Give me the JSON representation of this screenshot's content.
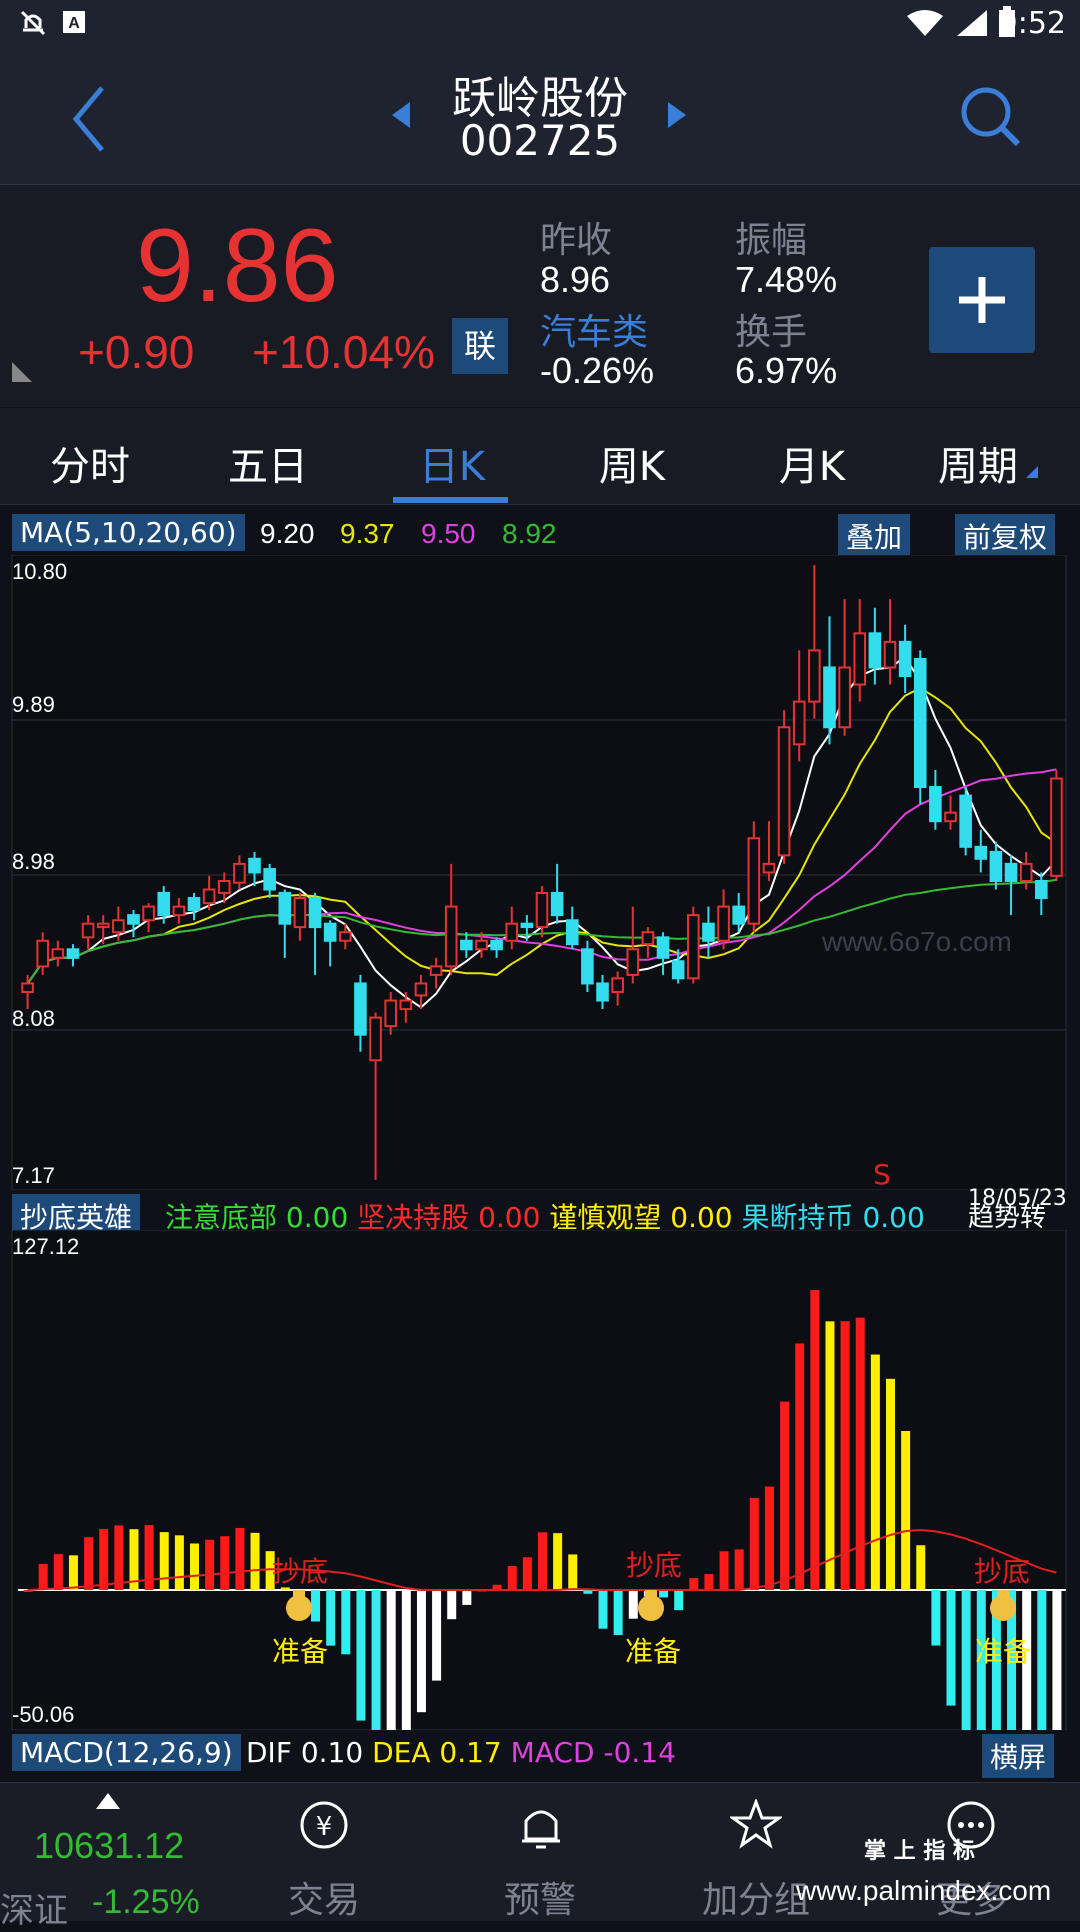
{
  "status": {
    "time": "9:52"
  },
  "header": {
    "name": "跃岭股份",
    "code": "002725"
  },
  "quote": {
    "price": "9.86",
    "change": "+0.90",
    "change_pct": "+10.04%",
    "lian": "联",
    "prev_close_label": "昨收",
    "prev_close": "8.96",
    "amplitude_label": "振幅",
    "amplitude": "7.48%",
    "sector": "汽车类",
    "sector_chg": "-0.26%",
    "turnover_label": "换手",
    "turnover": "6.97%"
  },
  "tabs": [
    {
      "label": "分时"
    },
    {
      "label": "五日"
    },
    {
      "label": "日K"
    },
    {
      "label": "周K"
    },
    {
      "label": "月K"
    },
    {
      "label": "周期"
    }
  ],
  "ma_legend": {
    "name": "MA(5,10,20,60)",
    "ma5": "9.20",
    "ma10": "9.37",
    "ma20": "9.50",
    "ma60": "8.92",
    "overlay": "叠加",
    "adjust": "前复权"
  },
  "kline_axis": [
    "10.80",
    "9.89",
    "8.98",
    "8.08",
    "7.17"
  ],
  "watermark": "www.6o7o.com",
  "signal_legend": {
    "name": "抄底英雄",
    "items": [
      {
        "label": "注意底部",
        "value": "0.00",
        "color": "#33dd33"
      },
      {
        "label": "坚决持股",
        "value": "0.00",
        "color": "#ff2a2a"
      },
      {
        "label": "谨慎观望",
        "value": "0.00",
        "color": "#ffee00"
      },
      {
        "label": "果断持币",
        "value": "0.00",
        "color": "#33ddee"
      }
    ],
    "trend": "趋势转",
    "date": "18/05/23",
    "s_mark": "S"
  },
  "ind_axis": {
    "top": "127.12",
    "bottom": "-50.06"
  },
  "markers": {
    "chaodi": "抄底",
    "zhunbei": "准备"
  },
  "macd_legend": {
    "name": "MACD(12,26,9)",
    "dif_label": "DIF",
    "dif": "0.10",
    "dea_label": "DEA",
    "dea": "0.17",
    "macd_label": "MACD",
    "macd": "-0.14",
    "landscape": "横屏"
  },
  "bottom_nav": {
    "index_value": "10631.12",
    "index_name": "深证",
    "index_pct": "-1.25%",
    "trade": "交易",
    "alert": "预警",
    "group": "加分组",
    "more": "更多",
    "brand_cn": "掌 上 指 标",
    "brand_url": "www.palmindex.com"
  },
  "colors": {
    "up": "#e63232",
    "down": "#33dded",
    "accent": "#3a7ed8",
    "ma5": "#ffffff",
    "ma10": "#e6e600",
    "ma20": "#e040e0",
    "ma60": "#33bb33"
  },
  "chart_data": {
    "type": "candlestick",
    "ylim": [
      7.17,
      10.8
    ],
    "candles": [
      [
        8.3,
        8.35,
        8.2,
        8.4
      ],
      [
        8.45,
        8.6,
        8.4,
        8.65
      ],
      [
        8.5,
        8.55,
        8.45,
        8.6
      ],
      [
        8.55,
        8.5,
        8.45,
        8.58
      ],
      [
        8.62,
        8.7,
        8.55,
        8.75
      ],
      [
        8.68,
        8.7,
        8.58,
        8.75
      ],
      [
        8.65,
        8.72,
        8.6,
        8.8
      ],
      [
        8.75,
        8.7,
        8.62,
        8.78
      ],
      [
        8.72,
        8.8,
        8.65,
        8.82
      ],
      [
        8.88,
        8.75,
        8.7,
        8.92
      ],
      [
        8.75,
        8.8,
        8.7,
        8.85
      ],
      [
        8.85,
        8.78,
        8.72,
        8.88
      ],
      [
        8.82,
        8.9,
        8.78,
        8.98
      ],
      [
        8.88,
        8.95,
        8.82,
        9.0
      ],
      [
        8.94,
        9.05,
        8.9,
        9.1
      ],
      [
        9.08,
        9.0,
        8.92,
        9.12
      ],
      [
        9.02,
        8.9,
        8.85,
        9.05
      ],
      [
        8.88,
        8.7,
        8.5,
        8.9
      ],
      [
        8.68,
        8.85,
        8.6,
        8.88
      ],
      [
        8.85,
        8.68,
        8.4,
        8.88
      ],
      [
        8.7,
        8.6,
        8.45,
        8.72
      ],
      [
        8.6,
        8.65,
        8.55,
        8.7
      ],
      [
        8.35,
        8.05,
        7.95,
        8.4
      ],
      [
        7.9,
        8.15,
        7.2,
        8.18
      ],
      [
        8.1,
        8.25,
        8.05,
        8.3
      ],
      [
        8.2,
        8.25,
        8.12,
        8.3
      ],
      [
        8.28,
        8.35,
        8.2,
        8.4
      ],
      [
        8.4,
        8.45,
        8.32,
        8.5
      ],
      [
        8.45,
        8.8,
        8.4,
        9.05
      ],
      [
        8.6,
        8.55,
        8.5,
        8.65
      ],
      [
        8.55,
        8.6,
        8.5,
        8.65
      ],
      [
        8.6,
        8.55,
        8.5,
        8.62
      ],
      [
        8.6,
        8.7,
        8.55,
        8.8
      ],
      [
        8.7,
        8.68,
        8.6,
        8.75
      ],
      [
        8.68,
        8.88,
        8.62,
        8.92
      ],
      [
        8.88,
        8.75,
        8.7,
        9.05
      ],
      [
        8.72,
        8.58,
        8.55,
        8.8
      ],
      [
        8.55,
        8.35,
        8.3,
        8.6
      ],
      [
        8.35,
        8.25,
        8.2,
        8.4
      ],
      [
        8.3,
        8.38,
        8.22,
        8.42
      ],
      [
        8.4,
        8.55,
        8.35,
        8.8
      ],
      [
        8.58,
        8.65,
        8.5,
        8.68
      ],
      [
        8.62,
        8.5,
        8.4,
        8.65
      ],
      [
        8.48,
        8.38,
        8.35,
        8.55
      ],
      [
        8.38,
        8.75,
        8.35,
        8.8
      ],
      [
        8.7,
        8.6,
        8.5,
        8.8
      ],
      [
        8.6,
        8.8,
        8.55,
        8.9
      ],
      [
        8.8,
        8.7,
        8.65,
        8.88
      ],
      [
        8.7,
        9.2,
        8.65,
        9.3
      ],
      [
        9.0,
        9.05,
        8.95,
        9.3
      ],
      [
        9.1,
        9.85,
        9.05,
        9.95
      ],
      [
        9.75,
        10.0,
        9.65,
        10.3
      ],
      [
        10.0,
        10.3,
        9.9,
        10.8
      ],
      [
        10.2,
        9.85,
        9.75,
        10.5
      ],
      [
        9.85,
        10.2,
        9.8,
        10.6
      ],
      [
        10.1,
        10.4,
        10.0,
        10.6
      ],
      [
        10.4,
        10.2,
        10.1,
        10.55
      ],
      [
        10.2,
        10.35,
        10.1,
        10.6
      ],
      [
        10.35,
        10.15,
        10.05,
        10.45
      ],
      [
        10.25,
        9.5,
        9.4,
        10.3
      ],
      [
        9.5,
        9.3,
        9.25,
        9.6
      ],
      [
        9.3,
        9.35,
        9.25,
        9.45
      ],
      [
        9.45,
        9.15,
        9.1,
        9.5
      ],
      [
        9.15,
        9.08,
        9.0,
        9.25
      ],
      [
        9.12,
        8.95,
        8.9,
        9.18
      ],
      [
        9.05,
        8.95,
        8.75,
        9.1
      ],
      [
        8.95,
        9.05,
        8.9,
        9.12
      ],
      [
        8.95,
        8.85,
        8.75,
        9.0
      ],
      [
        8.98,
        9.55,
        8.95,
        9.6
      ]
    ]
  }
}
